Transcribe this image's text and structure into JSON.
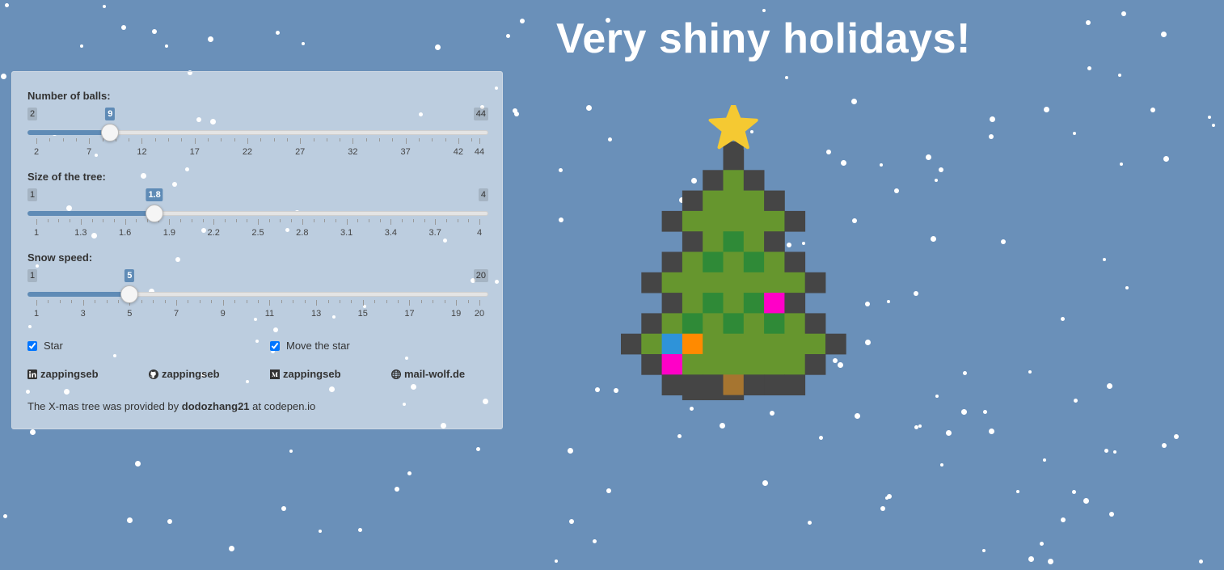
{
  "title": "Very shiny holidays!",
  "sliders": [
    {
      "label": "Number of balls:",
      "min": 2,
      "max": 44,
      "value": 9,
      "min_label": "2",
      "max_label": "44",
      "value_label": "9",
      "ticks": [
        "2",
        "7",
        "12",
        "17",
        "22",
        "27",
        "32",
        "37",
        "42",
        "44"
      ]
    },
    {
      "label": "Size of the tree:",
      "min": 1,
      "max": 4,
      "value": 1.8,
      "min_label": "1",
      "max_label": "4",
      "value_label": "1.8",
      "ticks": [
        "1",
        "1.3",
        "1.6",
        "1.9",
        "2.2",
        "2.5",
        "2.8",
        "3.1",
        "3.4",
        "3.7",
        "4"
      ]
    },
    {
      "label": "Snow speed:",
      "min": 1,
      "max": 20,
      "value": 5,
      "min_label": "1",
      "max_label": "20",
      "value_label": "5",
      "ticks": [
        "1",
        "3",
        "5",
        "7",
        "9",
        "11",
        "13",
        "15",
        "17",
        "19",
        "20"
      ]
    }
  ],
  "checkboxes": [
    {
      "label": "Star",
      "checked": true
    },
    {
      "label": "Move the star",
      "checked": true
    }
  ],
  "links": [
    {
      "icon": "linkedin-icon",
      "text": "zappingseb"
    },
    {
      "icon": "github-icon",
      "text": "zappingseb"
    },
    {
      "icon": "medium-icon",
      "text": "zappingseb"
    },
    {
      "icon": "globe-icon",
      "text": "mail-wolf.de"
    }
  ],
  "credit": {
    "before": "The X-mas tree was provided by ",
    "author": "dodozhang21",
    "after": " at codepen.io"
  },
  "colors": {
    "background": "#6a90b9",
    "accent": "#5f8bb6",
    "outline": "#454545",
    "leaf": "#66962e",
    "leaf_dark": "#2f8a37",
    "trunk": "#a67530",
    "star": "#f5c932",
    "ball_pink": "#ff00c7",
    "ball_blue": "#2e93d9",
    "ball_orange": "#ff8a00"
  }
}
